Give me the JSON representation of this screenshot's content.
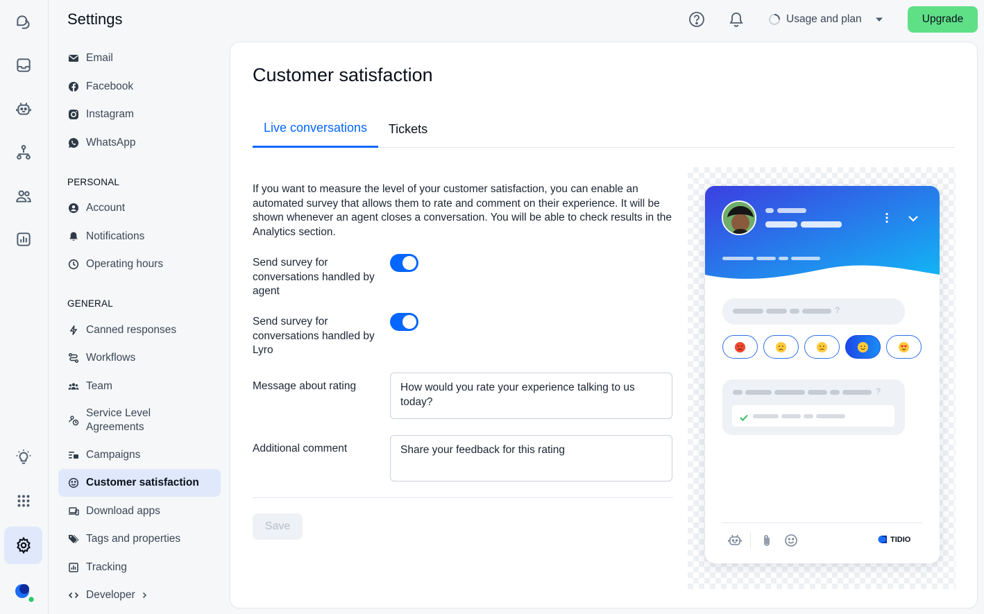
{
  "rail": {
    "items": [
      {
        "name": "tidio-logo-icon"
      },
      {
        "name": "inbox-icon"
      },
      {
        "name": "bot-icon"
      },
      {
        "name": "flows-icon"
      },
      {
        "name": "contacts-icon"
      },
      {
        "name": "analytics-icon"
      },
      {
        "name": "lightbulb-icon"
      },
      {
        "name": "apps-grid-icon"
      },
      {
        "name": "gear-icon"
      },
      {
        "name": "user-avatar"
      }
    ]
  },
  "nav": {
    "title": "Settings",
    "channels": [
      {
        "label": "Email",
        "icon": "mail-icon"
      },
      {
        "label": "Facebook",
        "icon": "facebook-icon"
      },
      {
        "label": "Instagram",
        "icon": "instagram-icon"
      },
      {
        "label": "WhatsApp",
        "icon": "whatsapp-icon"
      }
    ],
    "personal_heading": "PERSONAL",
    "personal": [
      {
        "label": "Account",
        "icon": "account-icon"
      },
      {
        "label": "Notifications",
        "icon": "bell-icon"
      },
      {
        "label": "Operating hours",
        "icon": "clock-icon"
      }
    ],
    "general_heading": "GENERAL",
    "general": [
      {
        "label": "Canned responses",
        "icon": "bolt-icon"
      },
      {
        "label": "Workflows",
        "icon": "workflow-icon"
      },
      {
        "label": "Team",
        "icon": "team-icon"
      },
      {
        "label": "Service Level Agreements",
        "icon": "sla-icon"
      },
      {
        "label": "Campaigns",
        "icon": "campaigns-icon"
      },
      {
        "label": "Customer satisfaction",
        "icon": "smile-icon"
      },
      {
        "label": "Download apps",
        "icon": "devices-icon"
      },
      {
        "label": "Tags and properties",
        "icon": "tag-icon"
      },
      {
        "label": "Tracking",
        "icon": "chart-icon"
      },
      {
        "label": "Developer",
        "icon": "code-icon"
      }
    ]
  },
  "topbar": {
    "usage_label": "Usage and plan",
    "upgrade_label": "Upgrade"
  },
  "main": {
    "title": "Customer satisfaction",
    "tabs": [
      {
        "label": "Live conversations",
        "active": true
      },
      {
        "label": "Tickets",
        "active": false
      }
    ],
    "description": "If you want to measure the level of your customer satisfaction, you can enable an automated survey that allows them to rate and comment on their experience. It will be shown whenever an agent closes a conversation. You will be able to check results in the Analytics section.",
    "agent_toggle_label": "Send survey for conversations handled by agent",
    "agent_toggle_on": true,
    "lyro_toggle_label": "Send survey for conversations handled by Lyro",
    "lyro_toggle_on": true,
    "rating_label": "Message about rating",
    "rating_value": "How would you rate your experience talking to us today?",
    "comment_label": "Additional comment",
    "comment_value": "Share your feedback for this rating",
    "save_label": "Save"
  },
  "preview": {
    "brand": "TIDIO",
    "colors": {
      "gradient_start": "#3c3fe0",
      "gradient_end": "#12b6f5",
      "accent": "#0566ff"
    }
  }
}
